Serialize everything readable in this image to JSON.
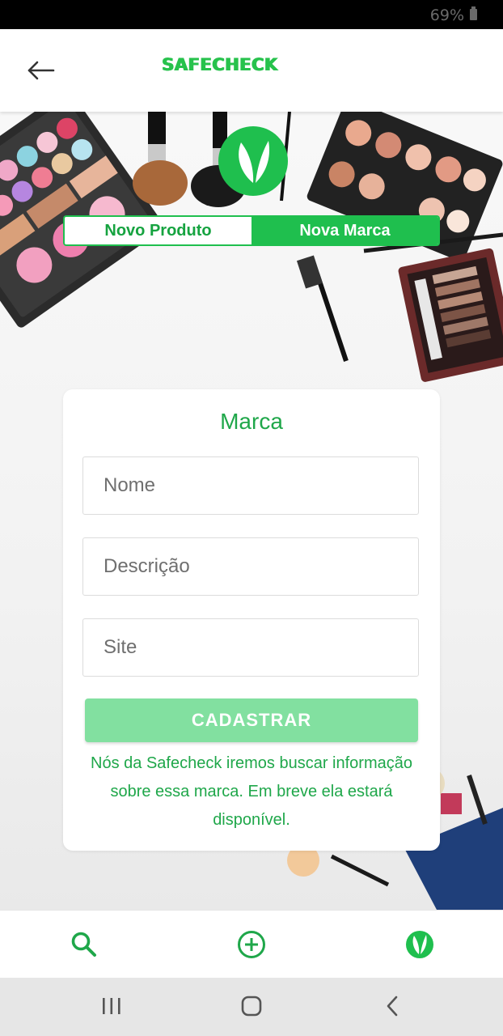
{
  "status_bar": {
    "battery": "69%"
  },
  "app_bar": {
    "title": "SAFECHECK"
  },
  "tabs": [
    {
      "label": "Novo Produto",
      "active": false
    },
    {
      "label": "Nova Marca",
      "active": true
    }
  ],
  "form": {
    "title": "Marca",
    "fields": {
      "name_placeholder": "Nome",
      "description_placeholder": "Descrição",
      "site_placeholder": "Site"
    },
    "submit_label": "CADASTRAR",
    "note": "Nós da Safecheck iremos buscar informação sobre essa marca. Em breve ela estará disponível."
  },
  "bottom_nav": [
    "search-icon",
    "add-circle-icon",
    "leaf-badge-icon"
  ],
  "system_nav": [
    "recent-apps-icon",
    "home-icon",
    "back-icon"
  ],
  "colors": {
    "brand_green": "#1fbf4e",
    "button_disabled": "#82e0a0",
    "text_green": "#1fa74a"
  }
}
